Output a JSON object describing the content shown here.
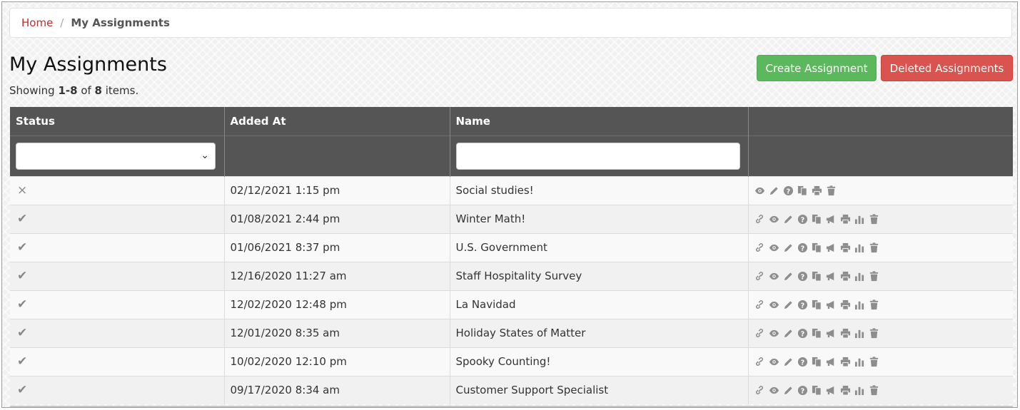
{
  "breadcrumb": {
    "home": "Home",
    "separator": "/",
    "current": "My Assignments"
  },
  "page": {
    "title": "My Assignments",
    "summary_prefix": "Showing ",
    "summary_range": "1-8",
    "summary_mid": " of ",
    "summary_total": "8",
    "summary_suffix": " items."
  },
  "buttons": {
    "create": "Create Assignment",
    "deleted": "Deleted Assignments"
  },
  "colors": {
    "create": "#5cb85c",
    "deleted": "#d9534f",
    "header": "#555555",
    "link": "#b8312f"
  },
  "table": {
    "headers": {
      "status": "Status",
      "added_at": "Added At",
      "name": "Name",
      "actions": ""
    },
    "filters": {
      "status_value": "",
      "name_value": ""
    },
    "rows": [
      {
        "status": "×",
        "status_icon": "x-icon",
        "added_at": "02/12/2021 1:15 pm",
        "name": "Social studies!",
        "actions": [
          "eye-icon",
          "pencil-icon",
          "question-icon",
          "copy-icon",
          "print-icon",
          "trash-icon"
        ]
      },
      {
        "status": "✔",
        "status_icon": "check-icon",
        "added_at": "01/08/2021 2:44 pm",
        "name": "Winter Math!",
        "actions": [
          "link-icon",
          "eye-icon",
          "pencil-icon",
          "question-icon",
          "copy-icon",
          "bullhorn-icon",
          "print-icon",
          "bar-chart-icon",
          "trash-icon"
        ]
      },
      {
        "status": "✔",
        "status_icon": "check-icon",
        "added_at": "01/06/2021 8:37 pm",
        "name": "U.S. Government",
        "actions": [
          "link-icon",
          "eye-icon",
          "pencil-icon",
          "question-icon",
          "copy-icon",
          "bullhorn-icon",
          "print-icon",
          "bar-chart-icon",
          "trash-icon"
        ]
      },
      {
        "status": "✔",
        "status_icon": "check-icon",
        "added_at": "12/16/2020 11:27 am",
        "name": "Staff Hospitality Survey",
        "actions": [
          "link-icon",
          "eye-icon",
          "pencil-icon",
          "question-icon",
          "copy-icon",
          "bullhorn-icon",
          "print-icon",
          "bar-chart-icon",
          "trash-icon"
        ]
      },
      {
        "status": "✔",
        "status_icon": "check-icon",
        "added_at": "12/02/2020 12:48 pm",
        "name": "La Navidad",
        "actions": [
          "link-icon",
          "eye-icon",
          "pencil-icon",
          "question-icon",
          "copy-icon",
          "bullhorn-icon",
          "print-icon",
          "bar-chart-icon",
          "trash-icon"
        ]
      },
      {
        "status": "✔",
        "status_icon": "check-icon",
        "added_at": "12/01/2020 8:35 am",
        "name": "Holiday States of Matter",
        "actions": [
          "link-icon",
          "eye-icon",
          "pencil-icon",
          "question-icon",
          "copy-icon",
          "bullhorn-icon",
          "print-icon",
          "bar-chart-icon",
          "trash-icon"
        ]
      },
      {
        "status": "✔",
        "status_icon": "check-icon",
        "added_at": "10/02/2020 12:10 pm",
        "name": "Spooky Counting!",
        "actions": [
          "link-icon",
          "eye-icon",
          "pencil-icon",
          "question-icon",
          "copy-icon",
          "bullhorn-icon",
          "print-icon",
          "bar-chart-icon",
          "trash-icon"
        ]
      },
      {
        "status": "✔",
        "status_icon": "check-icon",
        "added_at": "09/17/2020 8:34 am",
        "name": "Customer Support Specialist",
        "actions": [
          "link-icon",
          "eye-icon",
          "pencil-icon",
          "question-icon",
          "copy-icon",
          "bullhorn-icon",
          "print-icon",
          "bar-chart-icon",
          "trash-icon"
        ]
      }
    ]
  }
}
